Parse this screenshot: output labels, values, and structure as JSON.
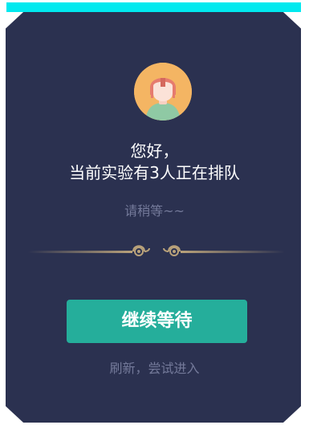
{
  "dialog": {
    "avatar_icon": "user-avatar-icon",
    "title": "您好，",
    "subtitle": "当前实验有3人正在排队",
    "wait_text": "请稍等~~",
    "continue_button_label": "继续等待",
    "refresh_link_label": "刷新，尝试进入"
  },
  "colors": {
    "accent_top_bar": "#00e9ef",
    "panel_background": "#2b3150",
    "button_green": "#25ae9b",
    "muted_text": "#747a9a",
    "divider_gold": "#b9a27a"
  }
}
